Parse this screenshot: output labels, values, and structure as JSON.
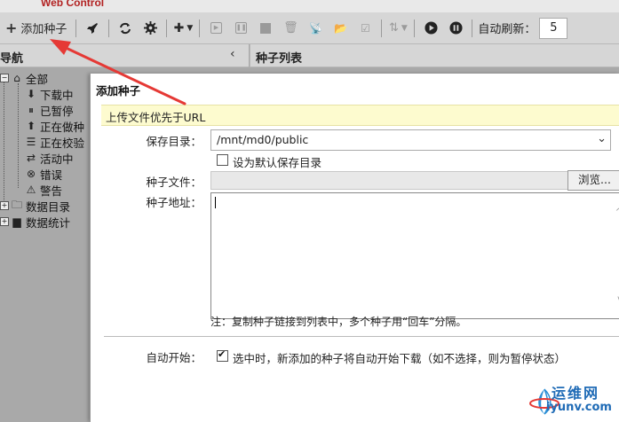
{
  "header": {
    "title": "Web Control"
  },
  "toolbar": {
    "add_label": "添加种子",
    "autorefresh_label": "自动刷新：",
    "autorefresh_value": "5"
  },
  "nav": {
    "title": "导航",
    "collapse_glyph": "‹",
    "items": [
      {
        "label": "全部",
        "icon": "home-icon"
      },
      {
        "label": "下载中",
        "icon": "download-icon"
      },
      {
        "label": "已暂停",
        "icon": "pause-circle-icon"
      },
      {
        "label": "正在做种",
        "icon": "upload-icon"
      },
      {
        "label": "正在校验",
        "icon": "list-icon"
      },
      {
        "label": "活动中",
        "icon": "exchange-icon"
      },
      {
        "label": "错误",
        "icon": "error-icon"
      },
      {
        "label": "警告",
        "icon": "warning-icon"
      },
      {
        "label": "数据目录",
        "icon": "folder-icon"
      },
      {
        "label": "数据统计",
        "icon": "bar-chart-icon"
      }
    ]
  },
  "list": {
    "title": "种子列表"
  },
  "dialog": {
    "title": "添加种子",
    "hint": "上传文件优先于URL",
    "save_dir_label": "保存目录：",
    "save_dir_value": "/mnt/md0/public",
    "default_dir_label": "设为默认保存目录",
    "default_dir_checked": false,
    "torrent_file_label": "种子文件：",
    "browse_label": "浏览...",
    "torrent_url_label": "种子地址：",
    "torrent_url_value": "",
    "note": "注：复制种子链接到列表中，多个种子用“回车”分隔。",
    "autostart_label": "自动开始：",
    "autostart_checked": true,
    "autostart_text": "选中时，新添加的种子将自动开始下载（如不选择，则为暂停状态）"
  },
  "watermark": {
    "line1": "运维网",
    "line2": "iyunv.com"
  },
  "colors": {
    "arrow": "#e53935",
    "hint_bg": "#fdfbcf",
    "toolbar_bg": "#d6d6d6"
  }
}
